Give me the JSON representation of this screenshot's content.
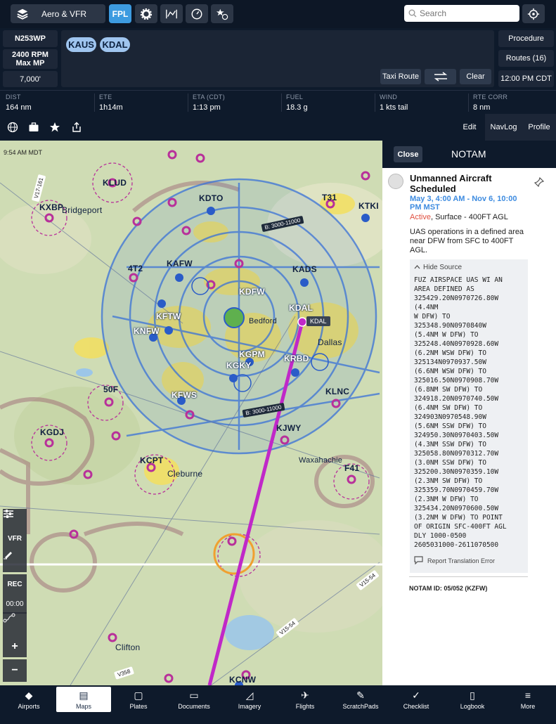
{
  "toolbar": {
    "layers_label": "Aero & VFR",
    "fpl_label": "FPL",
    "search_placeholder": "Search"
  },
  "flight_plan": {
    "tail": "N253WP",
    "power": "2400 RPM\nMax MP",
    "altitude": "7,000'",
    "route": [
      "KAUS",
      "KDAL"
    ],
    "taxi_route": "Taxi Route",
    "clear": "Clear",
    "procedure": "Procedure",
    "routes": "Routes (16)",
    "departure_time": "12:00 PM CDT"
  },
  "stats": [
    {
      "label": "DIST",
      "value": "164 nm"
    },
    {
      "label": "ETE",
      "value": "1h14m"
    },
    {
      "label": "ETA (CDT)",
      "value": "1:13 pm"
    },
    {
      "label": "FUEL",
      "value": "18.3 g"
    },
    {
      "label": "WIND",
      "value": "1 kts tail"
    },
    {
      "label": "RTE CORR",
      "value": "8 nm"
    }
  ],
  "panel_tabs": {
    "edit": "Edit",
    "navlog": "NavLog",
    "profile": "Profile"
  },
  "map": {
    "time": "9:54 AM MDT",
    "vfr": "VFR",
    "rec": "REC",
    "rec_time": "00:00",
    "labels": {
      "kdto": "KDTO",
      "kafw": "KAFW",
      "kdfw": "KDFW",
      "kdal": "KDAL",
      "kads": "KADS",
      "kftw": "KFTW",
      "knfw": "KNFW",
      "kgpm": "KGPM",
      "kgky": "KGKY",
      "krbd": "KRBD",
      "kfws": "KFWS",
      "klnc": "KLNC",
      "kjwy": "KJWY",
      "kgdj": "KGDJ",
      "kcpt": "KCPT",
      "klud": "KLUD",
      "kxbp": "KXBP",
      "ktki": "KTKI",
      "kcnw": "KCNW",
      "t31": "T31",
      "f41": "F41",
      "t4t2": "4T2",
      "f50": "50F",
      "bridgeport": "Bridgeport",
      "bedford": "Bedford",
      "dallas": "Dallas",
      "cleburne": "Cleburne",
      "waxahachie": "Waxahachie",
      "clifton": "Clifton",
      "tag_kdal": "KDAL"
    },
    "airways": {
      "b3000_11000_top": "B: 3000-11000",
      "b3000_11000_bottom": "B: 3000-11000",
      "v15_54_a": "V15-54",
      "v15_54_b": "V15-54",
      "v358": "V358",
      "v17_161": "V17-161"
    }
  },
  "notam": {
    "close": "Close",
    "title": "NOTAM",
    "heading": "Unmanned Aircraft Scheduled",
    "dates": "May 3, 4:00 AM - Nov 6, 10:00 PM MST",
    "status_active": "Active",
    "status_rest": ", Surface - 400FT AGL",
    "description": "UAS operations in a defined area near DFW from SFC to 400FT AGL.",
    "hide_source": "Hide Source",
    "source": "FUZ AIRSPACE UAS WI AN\nAREA DEFINED AS\n325429.20N0970726.80W\n(4.4NM\nW DFW) TO\n325348.90N0970840W\n(5.4NM W DFW) TO\n325248.40N0970928.60W\n(6.2NM WSW DFW) TO\n325134N0970937.50W\n(6.6NM WSW DFW) TO\n325016.50N0970908.70W\n(6.8NM SW DFW) TO\n324918.20N0970740.50W\n(6.4NM SW DFW) TO\n324903N0970548.90W\n(5.6NM SSW DFW) TO\n324950.30N0970403.50W\n(4.3NM SSW DFW) TO\n325058.80N0970312.70W\n(3.0NM SSW DFW) TO\n325200.30N0970359.10W\n(2.3NM SW DFW) TO\n325359.70N0970459.70W\n(2.3NM W DFW) TO\n325434.20N0970600.50W\n(3.2NM W DFW) TO POINT\nOF ORIGIN SFC-400FT AGL\nDLY 1000-0500\n2605031000-2611070500",
    "report": "Report Translation Error",
    "id": "NOTAM ID: 05/052 (KZFW)"
  },
  "tabs": [
    {
      "label": "Airports",
      "icon": "airports-icon"
    },
    {
      "label": "Maps",
      "icon": "maps-icon"
    },
    {
      "label": "Plates",
      "icon": "plates-icon"
    },
    {
      "label": "Documents",
      "icon": "documents-icon"
    },
    {
      "label": "Imagery",
      "icon": "imagery-icon"
    },
    {
      "label": "Flights",
      "icon": "flights-icon"
    },
    {
      "label": "ScratchPads",
      "icon": "scratchpads-icon"
    },
    {
      "label": "Checklist",
      "icon": "checklist-icon"
    },
    {
      "label": "Logbook",
      "icon": "logbook-icon"
    },
    {
      "label": "More",
      "icon": "more-icon"
    }
  ],
  "colors": {
    "accent": "#3d9be0",
    "route_line": "#c028c8",
    "bravo_airspace": "#3a72d8",
    "active_status": "#e05040"
  }
}
